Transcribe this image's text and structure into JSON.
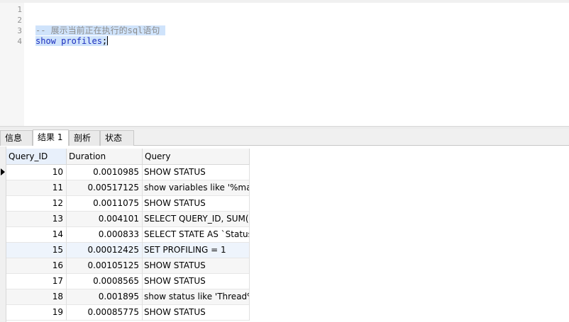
{
  "editor": {
    "line_numbers": [
      "1",
      "2",
      "3",
      "4"
    ],
    "line3_comment": "-- 展示当前正在执行的sql语句",
    "line4_keyword": "show profiles",
    "line4_semicolon": ";"
  },
  "tabs": [
    {
      "label": "信息"
    },
    {
      "label": "结果 1"
    },
    {
      "label": "剖析"
    },
    {
      "label": "状态"
    }
  ],
  "grid": {
    "columns": [
      "Query_ID",
      "Duration",
      "Query"
    ],
    "rows": [
      {
        "id": "10",
        "duration": "0.0010985",
        "query": "SHOW STATUS"
      },
      {
        "id": "11",
        "duration": "0.00517125",
        "query": "show variables like '%max"
      },
      {
        "id": "12",
        "duration": "0.0011075",
        "query": "SHOW STATUS"
      },
      {
        "id": "13",
        "duration": "0.004101",
        "query": "SELECT QUERY_ID, SUM(D"
      },
      {
        "id": "14",
        "duration": "0.000833",
        "query": "SELECT STATE AS `Status`"
      },
      {
        "id": "15",
        "duration": "0.00012425",
        "query": "SET PROFILING = 1"
      },
      {
        "id": "16",
        "duration": "0.00105125",
        "query": "SHOW STATUS"
      },
      {
        "id": "17",
        "duration": "0.0008565",
        "query": "SHOW STATUS"
      },
      {
        "id": "18",
        "duration": "0.001895",
        "query": "show status like 'Thread%"
      },
      {
        "id": "19",
        "duration": "0.00085775",
        "query": "SHOW STATUS"
      }
    ]
  },
  "colors": {
    "selection": "#cfe3fb",
    "keyword": "#1d2fbf",
    "comment": "#8c8c8c"
  }
}
